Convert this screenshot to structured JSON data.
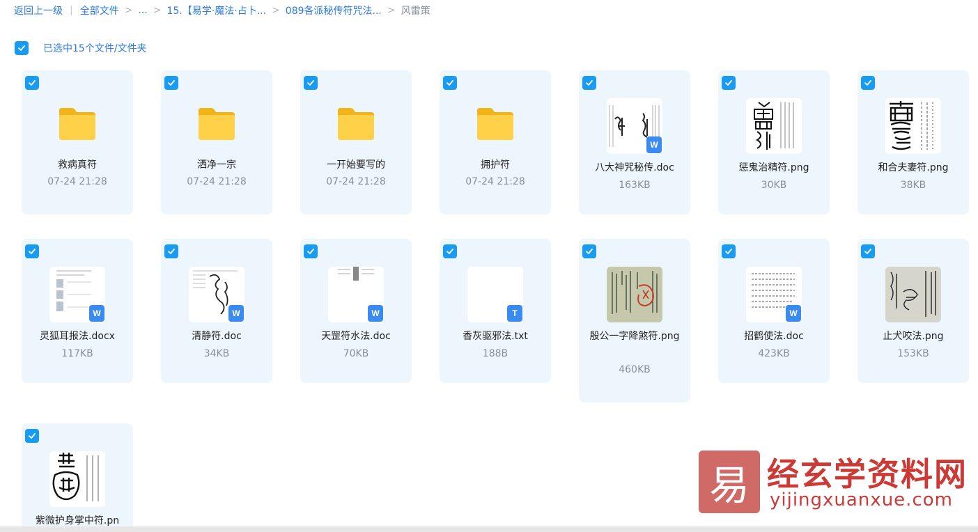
{
  "breadcrumb": {
    "back": "返回上一级",
    "divider": "|",
    "items": [
      "全部文件",
      "...",
      "15.【易学·魔法·占卜...",
      "089各派秘传符咒法..."
    ],
    "separator": ">",
    "current": "风雷策"
  },
  "selection": {
    "text": "已选中15个文件/文件夹"
  },
  "files": [
    {
      "name": "救病真符",
      "meta": "07-24 21:28",
      "kind": "folder"
    },
    {
      "name": "洒净一宗",
      "meta": "07-24 21:28",
      "kind": "folder"
    },
    {
      "name": "一开始要写的",
      "meta": "07-24 21:28",
      "kind": "folder"
    },
    {
      "name": "拥护符",
      "meta": "07-24 21:28",
      "kind": "folder"
    },
    {
      "name": "八大神咒秘传.doc",
      "meta": "163KB",
      "kind": "doc",
      "badge": "W"
    },
    {
      "name": "惩鬼治精符.png",
      "meta": "30KB",
      "kind": "png"
    },
    {
      "name": "和合夫妻符.png",
      "meta": "38KB",
      "kind": "png"
    },
    {
      "name": "灵狐耳报法.docx",
      "meta": "117KB",
      "kind": "doc",
      "badge": "W"
    },
    {
      "name": "清静符.doc",
      "meta": "34KB",
      "kind": "doc",
      "badge": "W"
    },
    {
      "name": "天罡符水法.doc",
      "meta": "70KB",
      "kind": "doc",
      "badge": "W"
    },
    {
      "name": "香灰驱邪法.txt",
      "meta": "188B",
      "kind": "txt",
      "badge": "T"
    },
    {
      "name": "殷公一字降煞符.png",
      "meta": "460KB",
      "kind": "png"
    },
    {
      "name": "招鹤使法.doc",
      "meta": "423KB",
      "kind": "doc",
      "badge": "W"
    },
    {
      "name": "止犬咬法.png",
      "meta": "153KB",
      "kind": "png"
    },
    {
      "name": "紫微护身掌中符.pn",
      "meta": "",
      "kind": "png"
    }
  ],
  "watermark": {
    "logo_char": "易",
    "title": "经玄学资料网",
    "url": "yijingxuanxue.com"
  },
  "colors": {
    "accent": "#2a7ae2",
    "checkbox": "#1a9bf2",
    "card_bg": "#eef6fd",
    "folder": "#f8c224",
    "watermark": "#cc3a36"
  }
}
